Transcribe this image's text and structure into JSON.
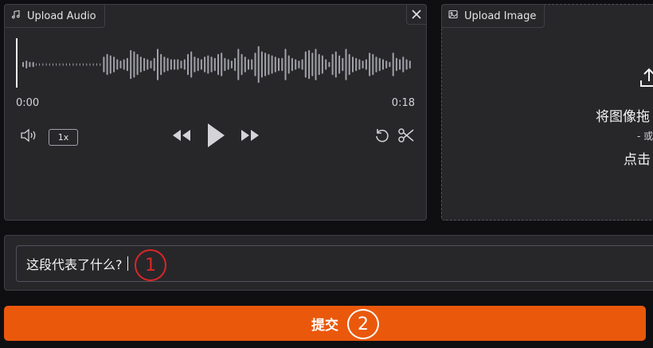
{
  "audio": {
    "tab_label": "Upload Audio",
    "time_start": "0:00",
    "time_end": "0:18",
    "speed": "1x",
    "bars": [
      2,
      3,
      2,
      2,
      1,
      1,
      1,
      1,
      1,
      1,
      1,
      1,
      1,
      1,
      1,
      1,
      1,
      1,
      1,
      1,
      1,
      1,
      1,
      1,
      6,
      8,
      7,
      6,
      4,
      3,
      4,
      5,
      11,
      10,
      8,
      6,
      5,
      4,
      3,
      5,
      12,
      8,
      6,
      5,
      4,
      4,
      4,
      3,
      4,
      8,
      10,
      6,
      5,
      4,
      6,
      7,
      6,
      5,
      8,
      9,
      5,
      4,
      3,
      5,
      12,
      8,
      6,
      4,
      4,
      9,
      14,
      10,
      9,
      8,
      7,
      6,
      5,
      5,
      12,
      7,
      5,
      4,
      3,
      4,
      10,
      11,
      9,
      12,
      8,
      7,
      4,
      2,
      8,
      10,
      7,
      5,
      12,
      8,
      6,
      5,
      4,
      3,
      4,
      9,
      8,
      6,
      5,
      4,
      3,
      2,
      9,
      5,
      4,
      6,
      4,
      3
    ]
  },
  "image": {
    "tab_label": "Upload Image",
    "drop_text": "将图像拖",
    "or_text": "- 或",
    "click_text": "点击"
  },
  "input": {
    "value": "这段代表了什么?"
  },
  "submit": {
    "label": "提交"
  },
  "markers": {
    "one": "1",
    "two": "2"
  },
  "colors": {
    "accent": "#ea580c",
    "marker_red": "#dc2626"
  }
}
